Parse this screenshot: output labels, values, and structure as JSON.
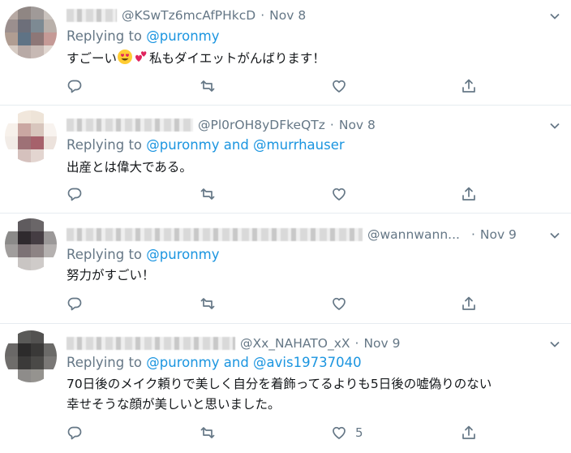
{
  "tweets": [
    {
      "handle": "@KSwTz6mcAfPHkcD",
      "date": "Nov 8",
      "replying_prefix": "Replying to",
      "mentions": "@puronmy",
      "text_before_emoji": "すごーい",
      "text_after_emoji": "私もダイエットがんばります！",
      "emoji": [
        "smiling-face-with-heart-eyes-icon",
        "two-hearts-icon"
      ],
      "like_count": ""
    },
    {
      "handle": "@Pl0rOH8yDFkeQTz",
      "date": "Nov 8",
      "replying_prefix": "Replying to",
      "mentions": "@puronmy and @murrhauser",
      "text": "出産とは偉大である。",
      "like_count": ""
    },
    {
      "handle": "@wannwann...",
      "date": "Nov 9",
      "replying_prefix": "Replying to",
      "mentions": "@puronmy",
      "text": "努力がすごい！",
      "like_count": ""
    },
    {
      "handle": "@Xx_NAHATO_xX",
      "date": "Nov 9",
      "replying_prefix": "Replying to",
      "mentions": "@puronmy and @avis19737040",
      "text_line1": "70日後のメイク頼りで美しく自分を着飾ってるよりも5日後の嘘偽りのない",
      "text_line2": "幸せそうな顔が美しいと思いました。",
      "like_count": "5"
    }
  ],
  "icons": {
    "reply": "reply-icon",
    "retweet": "retweet-icon",
    "like": "heart-icon",
    "share": "share-icon",
    "menu": "chevron-down-icon"
  },
  "colors": {
    "link": "#1b95e0",
    "secondary_text": "#657786",
    "divider": "#e6ecf0"
  }
}
